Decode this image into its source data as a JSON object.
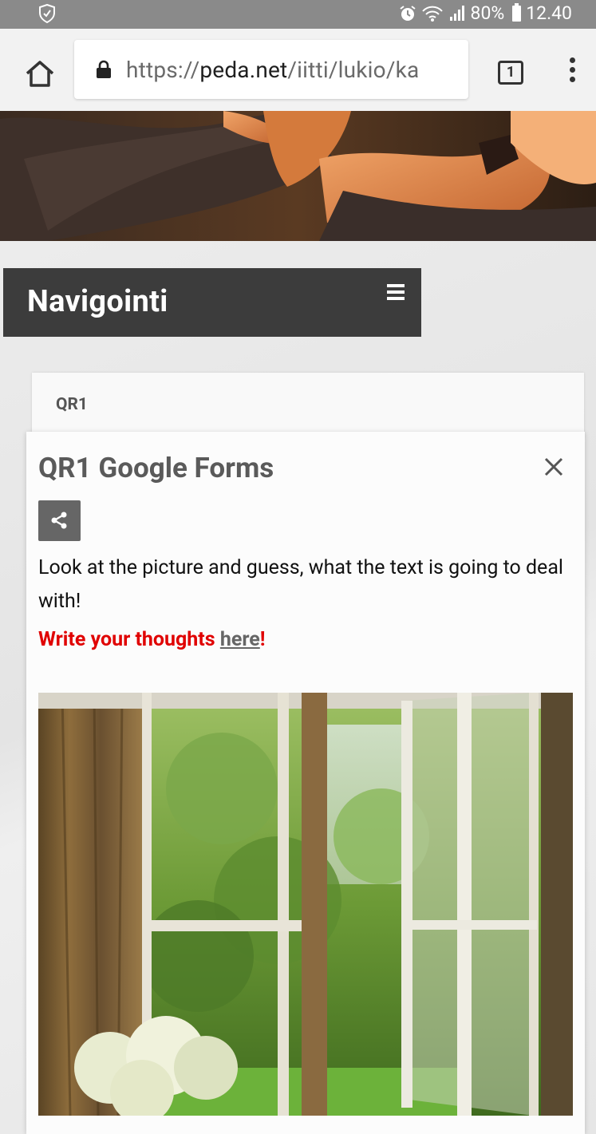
{
  "status_bar": {
    "battery": "80%",
    "time": "12.40",
    "icons": [
      "shield-icon",
      "alarm-icon",
      "wifi-icon",
      "signal-icon",
      "battery-icon"
    ]
  },
  "browser": {
    "url_scheme": "https://",
    "url_host": "peda.net",
    "url_path": "/iitti/lukio/ka",
    "tab_count": "1"
  },
  "nav": {
    "title": "Navigointi"
  },
  "breadcrumb": {
    "label": "QR1"
  },
  "panel": {
    "title": "QR1 Google Forms",
    "paragraph": "Look at the picture and guess, what the text is going to deal with!",
    "cta_prefix": "Write your thoughts ",
    "cta_link": "here",
    "cta_suffix": "!"
  },
  "colors": {
    "nav_bg": "#3c3c3c",
    "cta_red": "#e00000",
    "status_bar": "#8a8a8a"
  }
}
